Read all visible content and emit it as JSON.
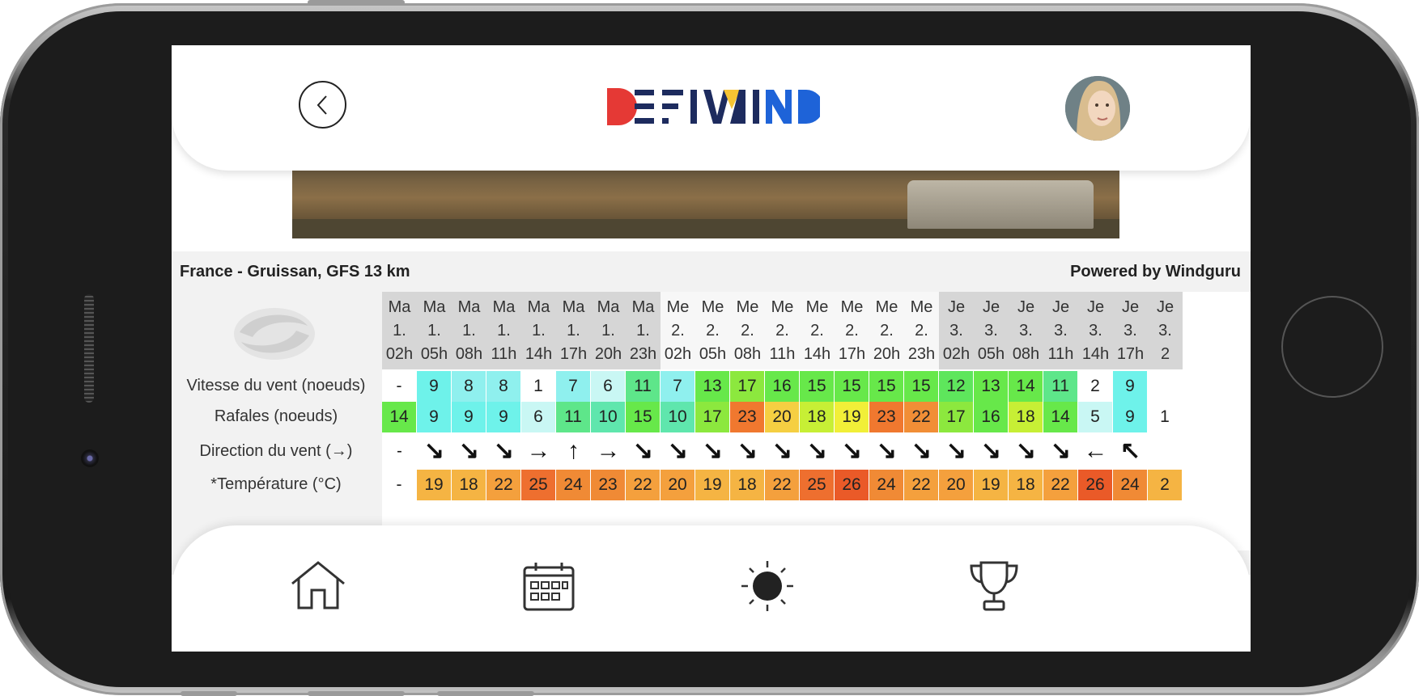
{
  "app": {
    "name": "DEFIWIND"
  },
  "header": {
    "back_icon": "chevron-left-icon",
    "avatar_icon": "user-avatar"
  },
  "forecast": {
    "location": "France - Gruissan, GFS 13 km",
    "powered_by": "Powered by Windguru",
    "row_labels": {
      "wind_speed": "Vitesse du vent (noeuds)",
      "gusts": "Rafales (noeuds)",
      "direction": "Direction du vent (→)",
      "temperature": "*Température (°C)"
    },
    "columns": [
      {
        "day": "Ma",
        "date": "1.",
        "hour": "02h",
        "wind": "-",
        "gust": "14",
        "dir": "-",
        "temp": "-"
      },
      {
        "day": "Ma",
        "date": "1.",
        "hour": "05h",
        "wind": "9",
        "gust": "9",
        "dir": "↘",
        "temp": "19"
      },
      {
        "day": "Ma",
        "date": "1.",
        "hour": "08h",
        "wind": "8",
        "gust": "9",
        "dir": "↘",
        "temp": "18"
      },
      {
        "day": "Ma",
        "date": "1.",
        "hour": "11h",
        "wind": "8",
        "gust": "9",
        "dir": "↘",
        "temp": "22"
      },
      {
        "day": "Ma",
        "date": "1.",
        "hour": "14h",
        "wind": "1",
        "gust": "6",
        "dir": "→",
        "temp": "25"
      },
      {
        "day": "Ma",
        "date": "1.",
        "hour": "17h",
        "wind": "7",
        "gust": "11",
        "dir": "↑",
        "temp": "24"
      },
      {
        "day": "Ma",
        "date": "1.",
        "hour": "20h",
        "wind": "6",
        "gust": "10",
        "dir": "→",
        "temp": "23"
      },
      {
        "day": "Ma",
        "date": "1.",
        "hour": "23h",
        "wind": "11",
        "gust": "15",
        "dir": "↘",
        "temp": "22"
      },
      {
        "day": "Me",
        "date": "2.",
        "hour": "02h",
        "wind": "7",
        "gust": "10",
        "dir": "↘",
        "temp": "20"
      },
      {
        "day": "Me",
        "date": "2.",
        "hour": "05h",
        "wind": "13",
        "gust": "17",
        "dir": "↘",
        "temp": "19"
      },
      {
        "day": "Me",
        "date": "2.",
        "hour": "08h",
        "wind": "17",
        "gust": "23",
        "dir": "↘",
        "temp": "18"
      },
      {
        "day": "Me",
        "date": "2.",
        "hour": "11h",
        "wind": "16",
        "gust": "20",
        "dir": "↘",
        "temp": "22"
      },
      {
        "day": "Me",
        "date": "2.",
        "hour": "14h",
        "wind": "15",
        "gust": "18",
        "dir": "↘",
        "temp": "25"
      },
      {
        "day": "Me",
        "date": "2.",
        "hour": "17h",
        "wind": "15",
        "gust": "19",
        "dir": "↘",
        "temp": "26"
      },
      {
        "day": "Me",
        "date": "2.",
        "hour": "20h",
        "wind": "15",
        "gust": "23",
        "dir": "↘",
        "temp": "24"
      },
      {
        "day": "Me",
        "date": "2.",
        "hour": "23h",
        "wind": "15",
        "gust": "22",
        "dir": "↘",
        "temp": "22"
      },
      {
        "day": "Je",
        "date": "3.",
        "hour": "02h",
        "wind": "12",
        "gust": "17",
        "dir": "↘",
        "temp": "20"
      },
      {
        "day": "Je",
        "date": "3.",
        "hour": "05h",
        "wind": "13",
        "gust": "16",
        "dir": "↘",
        "temp": "19"
      },
      {
        "day": "Je",
        "date": "3.",
        "hour": "08h",
        "wind": "14",
        "gust": "18",
        "dir": "↘",
        "temp": "18"
      },
      {
        "day": "Je",
        "date": "3.",
        "hour": "11h",
        "wind": "11",
        "gust": "14",
        "dir": "↘",
        "temp": "22"
      },
      {
        "day": "Je",
        "date": "3.",
        "hour": "14h",
        "wind": "2",
        "gust": "5",
        "dir": "←",
        "temp": "26"
      },
      {
        "day": "Je",
        "date": "3.",
        "hour": "17h",
        "wind": "9",
        "gust": "9",
        "dir": "↖",
        "temp": "24"
      },
      {
        "day": "Je",
        "date": "3.",
        "hour": "2",
        "wind": "",
        "gust": "1",
        "dir": "",
        "temp": "2"
      }
    ]
  },
  "bottom_nav": [
    {
      "icon": "home-icon"
    },
    {
      "icon": "calendar-icon"
    },
    {
      "icon": "sun-icon"
    },
    {
      "icon": "trophy-icon"
    }
  ],
  "colors": {
    "logo_red": "#e53935",
    "logo_navy": "#1d2b5e",
    "logo_yellow": "#f6c433",
    "logo_blue": "#1e63d8"
  }
}
